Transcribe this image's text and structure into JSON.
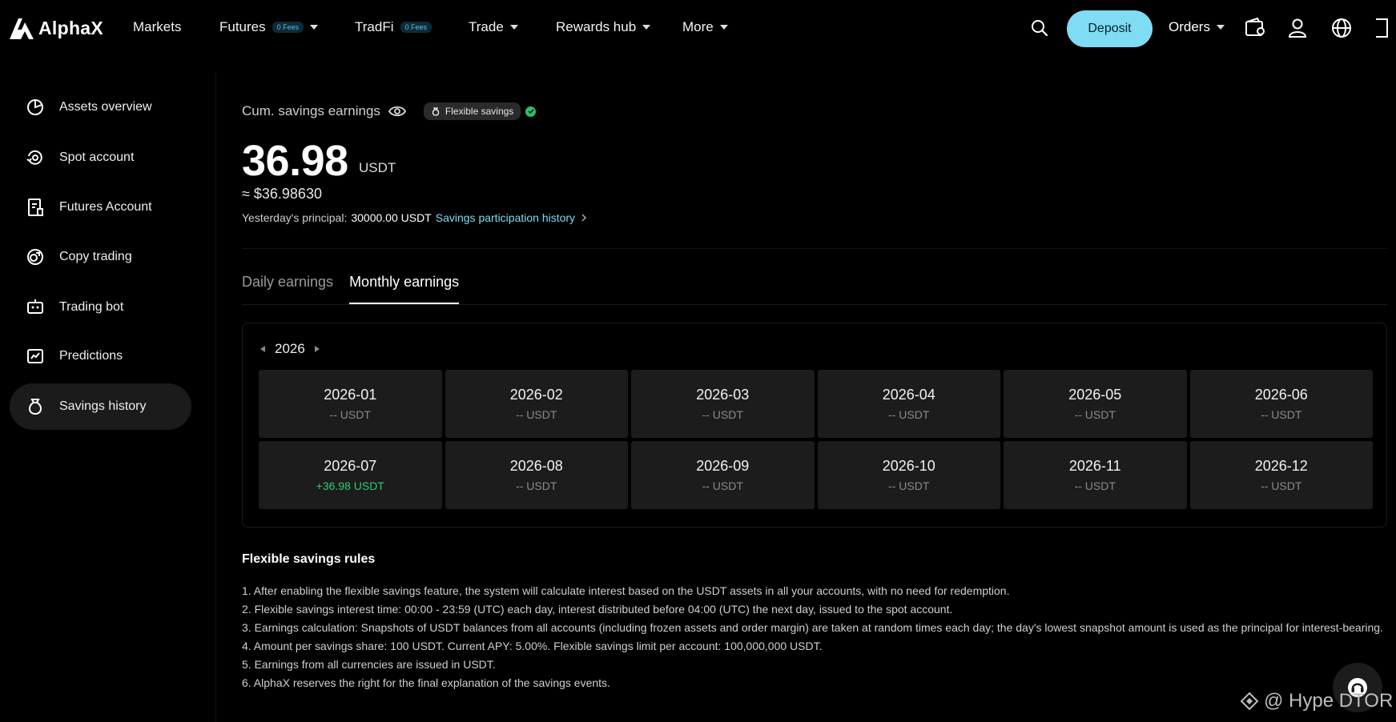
{
  "brand": {
    "name": "AlphaX"
  },
  "nav": {
    "markets": "Markets",
    "futures": "Futures",
    "futures_badge": "0 Fees",
    "tradfi": "TradFi",
    "tradfi_badge": "0 Fees",
    "trade": "Trade",
    "rewards": "Rewards hub",
    "more": "More",
    "deposit": "Deposit",
    "orders": "Orders"
  },
  "sidebar": {
    "items": [
      {
        "label": "Assets overview",
        "icon": "pie-chart-icon"
      },
      {
        "label": "Spot account",
        "icon": "spot-account-icon"
      },
      {
        "label": "Futures Account",
        "icon": "futures-account-icon"
      },
      {
        "label": "Copy trading",
        "icon": "copy-trading-icon"
      },
      {
        "label": "Trading bot",
        "icon": "trading-bot-icon"
      },
      {
        "label": "Predictions",
        "icon": "predictions-icon"
      },
      {
        "label": "Savings history",
        "icon": "savings-bag-icon",
        "active": true
      }
    ]
  },
  "summary": {
    "label": "Cum. savings earnings",
    "badge": "Flexible savings",
    "amount": "36.98",
    "unit": "USDT",
    "approx": "≈ $36.98630",
    "principal_label": "Yesterday's principal:",
    "principal_value": "30000.00 USDT",
    "history_link": "Savings participation history"
  },
  "tabs": {
    "daily": "Daily earnings",
    "monthly": "Monthly earnings"
  },
  "calendar": {
    "year": "2026",
    "months": [
      {
        "month": "2026-01",
        "value": "-- USDT"
      },
      {
        "month": "2026-02",
        "value": "-- USDT"
      },
      {
        "month": "2026-03",
        "value": "-- USDT"
      },
      {
        "month": "2026-04",
        "value": "-- USDT"
      },
      {
        "month": "2026-05",
        "value": "-- USDT"
      },
      {
        "month": "2026-06",
        "value": "-- USDT"
      },
      {
        "month": "2026-07",
        "value": "+36.98 USDT"
      },
      {
        "month": "2026-08",
        "value": "-- USDT"
      },
      {
        "month": "2026-09",
        "value": "-- USDT"
      },
      {
        "month": "2026-10",
        "value": "-- USDT"
      },
      {
        "month": "2026-11",
        "value": "-- USDT"
      },
      {
        "month": "2026-12",
        "value": "-- USDT"
      }
    ]
  },
  "rules": {
    "title": "Flexible savings rules",
    "items": [
      "1. After enabling the flexible savings feature, the system will calculate interest based on the USDT assets in all your accounts, with no need for redemption.",
      "2. Flexible savings interest time: 00:00 - 23:59 (UTC) each day, interest distributed before 04:00 (UTC) the next day, issued to the spot account.",
      "3. Earnings calculation: Snapshots of USDT balances from all accounts (including frozen assets and order margin) are taken at random times each day; the day's lowest snapshot amount is used as the principal for interest-bearing.",
      "4. Amount per savings share: 100 USDT. Current APY: 5.00%. Flexible savings limit per account: 100,000,000 USDT.",
      "5. Earnings from all currencies are issued in USDT.",
      "6. AlphaX reserves the right for the final explanation of the savings events."
    ]
  },
  "watermark": "@ Hype DTOR",
  "colors": {
    "accent": "#7fdcf3",
    "positive": "#2ecc71",
    "background": "#000000"
  }
}
